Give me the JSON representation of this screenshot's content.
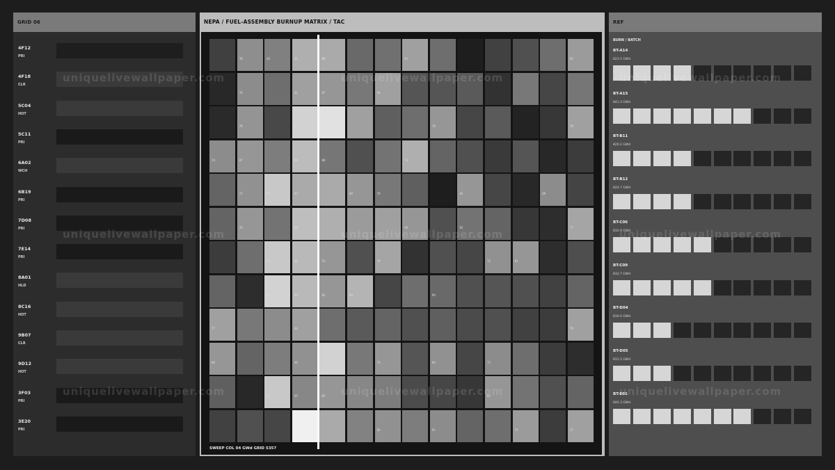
{
  "left": {
    "title": "GRID 06",
    "rows": [
      {
        "code": "4F12",
        "status": "PRI",
        "color": "#1e1e1e"
      },
      {
        "code": "4F18",
        "status": "CLR",
        "color": "#3a3a3a"
      },
      {
        "code": "5C04",
        "status": "HOT",
        "color": "#3a3a3a"
      },
      {
        "code": "5C11",
        "status": "PRI",
        "color": "#1a1a1a"
      },
      {
        "code": "6A02",
        "status": "WCH",
        "color": "#3a3a3a"
      },
      {
        "code": "6B19",
        "status": "PRI",
        "color": "#1a1a1a"
      },
      {
        "code": "7D08",
        "status": "PRI",
        "color": "#1a1a1a"
      },
      {
        "code": "7E14",
        "status": "PRI",
        "color": "#1a1a1a"
      },
      {
        "code": "8A01",
        "status": "HLD",
        "color": "#3a3a3a"
      },
      {
        "code": "8C16",
        "status": "HOT",
        "color": "#3a3a3a"
      },
      {
        "code": "9B07",
        "status": "CLR",
        "color": "#3a3a3a"
      },
      {
        "code": "9D12",
        "status": "HOT",
        "color": "#3a3a3a"
      },
      {
        "code": "3F03",
        "status": "PRI",
        "color": "#1a1a1a"
      },
      {
        "code": "3E20",
        "status": "PRI",
        "color": "#1a1a1a"
      }
    ]
  },
  "center": {
    "title": "NEPA / FUEL-ASSEMBLY BURNUP MATRIX  /  TAC",
    "footer": "SWEEP COL 04  GWd  GRID 5357",
    "sweep_col": 4,
    "matrix": [
      [
        [
          64,
          ""
        ],
        [
          142,
          "78"
        ],
        [
          128,
          "82"
        ],
        [
          175,
          "31"
        ],
        [
          170,
          "88"
        ],
        [
          105,
          ""
        ],
        [
          112,
          ""
        ],
        [
          160,
          "91"
        ],
        [
          110,
          ""
        ],
        [
          30,
          ""
        ],
        [
          65,
          ""
        ],
        [
          80,
          ""
        ],
        [
          110,
          ""
        ],
        [
          155,
          "92"
        ]
      ],
      [
        [
          40,
          ""
        ],
        [
          140,
          "76"
        ],
        [
          110,
          ""
        ],
        [
          160,
          "41"
        ],
        [
          150,
          "87"
        ],
        [
          120,
          ""
        ],
        [
          160,
          "94"
        ],
        [
          85,
          ""
        ],
        [
          85,
          ""
        ],
        [
          90,
          ""
        ],
        [
          50,
          ""
        ],
        [
          120,
          ""
        ],
        [
          70,
          ""
        ],
        [
          118,
          ""
        ]
      ],
      [
        [
          42,
          ""
        ],
        [
          148,
          "76"
        ],
        [
          72,
          ""
        ],
        [
          210,
          "57"
        ],
        [
          225,
          ""
        ],
        [
          160,
          ""
        ],
        [
          95,
          ""
        ],
        [
          110,
          ""
        ],
        [
          150,
          "78"
        ],
        [
          70,
          ""
        ],
        [
          90,
          ""
        ],
        [
          35,
          ""
        ],
        [
          55,
          ""
        ],
        [
          160,
          "78"
        ]
      ],
      [
        [
          140,
          "74"
        ],
        [
          150,
          "87"
        ],
        [
          125,
          ""
        ],
        [
          188,
          "50"
        ],
        [
          118,
          "88"
        ],
        [
          80,
          ""
        ],
        [
          115,
          ""
        ],
        [
          175,
          "73"
        ],
        [
          100,
          ""
        ],
        [
          80,
          ""
        ],
        [
          58,
          ""
        ],
        [
          85,
          ""
        ],
        [
          40,
          ""
        ],
        [
          60,
          ""
        ]
      ],
      [
        [
          100,
          ""
        ],
        [
          145,
          "71"
        ],
        [
          200,
          "77"
        ],
        [
          170,
          "43"
        ],
        [
          170,
          ""
        ],
        [
          150,
          "80"
        ],
        [
          120,
          "76"
        ],
        [
          95,
          ""
        ],
        [
          30,
          ""
        ],
        [
          150,
          "82"
        ],
        [
          70,
          ""
        ],
        [
          40,
          ""
        ],
        [
          140,
          "89"
        ],
        [
          68,
          ""
        ]
      ],
      [
        [
          100,
          ""
        ],
        [
          150,
          "76"
        ],
        [
          115,
          ""
        ],
        [
          190,
          "48"
        ],
        [
          175,
          ""
        ],
        [
          155,
          ""
        ],
        [
          160,
          ""
        ],
        [
          150,
          "90"
        ],
        [
          80,
          ""
        ],
        [
          115,
          "92"
        ],
        [
          100,
          ""
        ],
        [
          55,
          ""
        ],
        [
          45,
          ""
        ],
        [
          165,
          "77"
        ]
      ],
      [
        [
          60,
          ""
        ],
        [
          110,
          ""
        ],
        [
          200,
          "57"
        ],
        [
          185,
          "41"
        ],
        [
          150,
          "53"
        ],
        [
          80,
          ""
        ],
        [
          165,
          "79"
        ],
        [
          50,
          ""
        ],
        [
          80,
          ""
        ],
        [
          70,
          ""
        ],
        [
          145,
          "72"
        ],
        [
          150,
          "81"
        ],
        [
          45,
          ""
        ],
        [
          78,
          ""
        ]
      ],
      [
        [
          100,
          ""
        ],
        [
          45,
          ""
        ],
        [
          210,
          "61"
        ],
        [
          185,
          "44"
        ],
        [
          150,
          "82"
        ],
        [
          180,
          "83"
        ],
        [
          70,
          ""
        ],
        [
          110,
          ""
        ],
        [
          105,
          "90"
        ],
        [
          80,
          ""
        ],
        [
          85,
          ""
        ],
        [
          80,
          ""
        ],
        [
          65,
          ""
        ],
        [
          100,
          ""
        ]
      ],
      [
        [
          160,
          "77"
        ],
        [
          120,
          ""
        ],
        [
          140,
          ""
        ],
        [
          160,
          "49"
        ],
        [
          110,
          ""
        ],
        [
          90,
          ""
        ],
        [
          100,
          ""
        ],
        [
          80,
          ""
        ],
        [
          95,
          ""
        ],
        [
          75,
          ""
        ],
        [
          80,
          ""
        ],
        [
          65,
          ""
        ],
        [
          60,
          ""
        ],
        [
          160,
          "79"
        ]
      ],
      [
        [
          150,
          "80"
        ],
        [
          100,
          ""
        ],
        [
          125,
          ""
        ],
        [
          145,
          "46"
        ],
        [
          210,
          ""
        ],
        [
          120,
          ""
        ],
        [
          150,
          "76"
        ],
        [
          85,
          ""
        ],
        [
          145,
          "94"
        ],
        [
          70,
          ""
        ],
        [
          140,
          "71"
        ],
        [
          110,
          ""
        ],
        [
          60,
          ""
        ],
        [
          45,
          ""
        ]
      ],
      [
        [
          95,
          ""
        ],
        [
          40,
          ""
        ],
        [
          200,
          "73"
        ],
        [
          135,
          "45"
        ],
        [
          150,
          "85"
        ],
        [
          135,
          ""
        ],
        [
          125,
          ""
        ],
        [
          75,
          ""
        ],
        [
          70,
          ""
        ],
        [
          55,
          ""
        ],
        [
          150,
          "84"
        ],
        [
          115,
          ""
        ],
        [
          80,
          ""
        ],
        [
          100,
          ""
        ]
      ],
      [
        [
          65,
          ""
        ],
        [
          80,
          ""
        ],
        [
          70,
          ""
        ],
        [
          240,
          ""
        ],
        [
          170,
          ""
        ],
        [
          130,
          ""
        ],
        [
          145,
          "90"
        ],
        [
          125,
          ""
        ],
        [
          140,
          "91"
        ],
        [
          100,
          ""
        ],
        [
          110,
          ""
        ],
        [
          155,
          "75"
        ],
        [
          60,
          ""
        ],
        [
          160,
          "77"
        ]
      ]
    ]
  },
  "right": {
    "title": "REF",
    "subtitle": "BURN / BATCH",
    "batches": [
      {
        "id": "BT-A14",
        "value": "823.5 GWd",
        "filled": 4
      },
      {
        "id": "BT-A15",
        "value": "841.3 GWd",
        "filled": 7
      },
      {
        "id": "BT-B11",
        "value": "820.2 GWd",
        "filled": 4
      },
      {
        "id": "BT-B12",
        "value": "824.7 GWd",
        "filled": 4
      },
      {
        "id": "BT-C06",
        "value": "832.9 GWd",
        "filled": 5
      },
      {
        "id": "BT-C09",
        "value": "832.7 GWd",
        "filled": 5
      },
      {
        "id": "BT-D04",
        "value": "816.0 GWd",
        "filled": 3
      },
      {
        "id": "BT-D05",
        "value": "815.2 GWd",
        "filled": 3
      },
      {
        "id": "BT-E01",
        "value": "844.3 GWd",
        "filled": 7
      }
    ],
    "block_total": 10,
    "filled_color": "#d6d6d6",
    "empty_color": "#252525"
  },
  "watermark": "uniquelivewallpaper.com"
}
